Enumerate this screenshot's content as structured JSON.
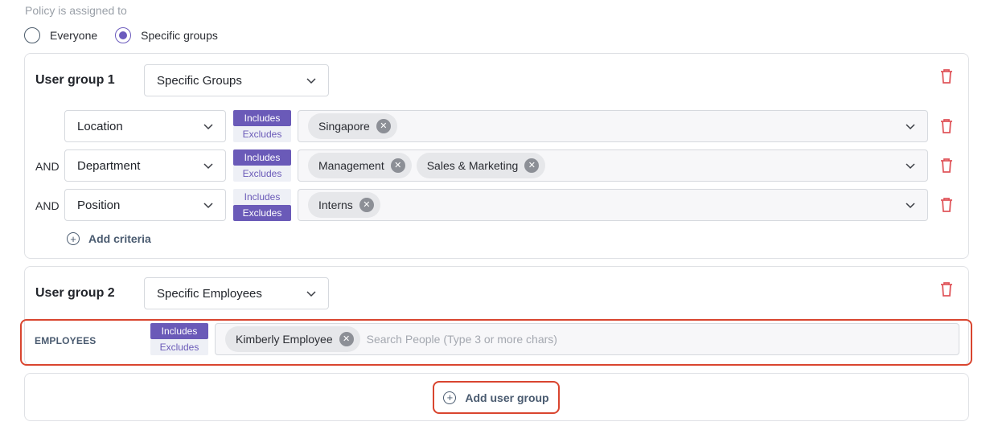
{
  "assignment": {
    "label": "Policy is assigned to",
    "options": [
      {
        "label": "Everyone",
        "checked": false
      },
      {
        "label": "Specific groups",
        "checked": true
      }
    ]
  },
  "group1": {
    "title": "User group 1",
    "type": "Specific Groups",
    "criteria": [
      {
        "connector": "",
        "field": "Location",
        "includes": "Includes",
        "excludes": "Excludes",
        "mode": "includes",
        "values": [
          "Singapore"
        ]
      },
      {
        "connector": "AND",
        "field": "Department",
        "includes": "Includes",
        "excludes": "Excludes",
        "mode": "includes",
        "values": [
          "Management",
          "Sales & Marketing"
        ]
      },
      {
        "connector": "AND",
        "field": "Position",
        "includes": "Includes",
        "excludes": "Excludes",
        "mode": "excludes",
        "values": [
          "Interns"
        ]
      }
    ],
    "add_criteria": "Add criteria"
  },
  "group2": {
    "title": "User group 2",
    "type": "Specific Employees",
    "employees_label": "EMPLOYEES",
    "includes": "Includes",
    "excludes": "Excludes",
    "mode": "includes",
    "selected": [
      "Kimberly Employee"
    ],
    "search_placeholder": "Search People (Type 3 or more chars)"
  },
  "add_user_group": "Add user group",
  "colors": {
    "accent": "#6a5ab8",
    "delete": "#e0565b",
    "highlight": "#d9452f"
  }
}
